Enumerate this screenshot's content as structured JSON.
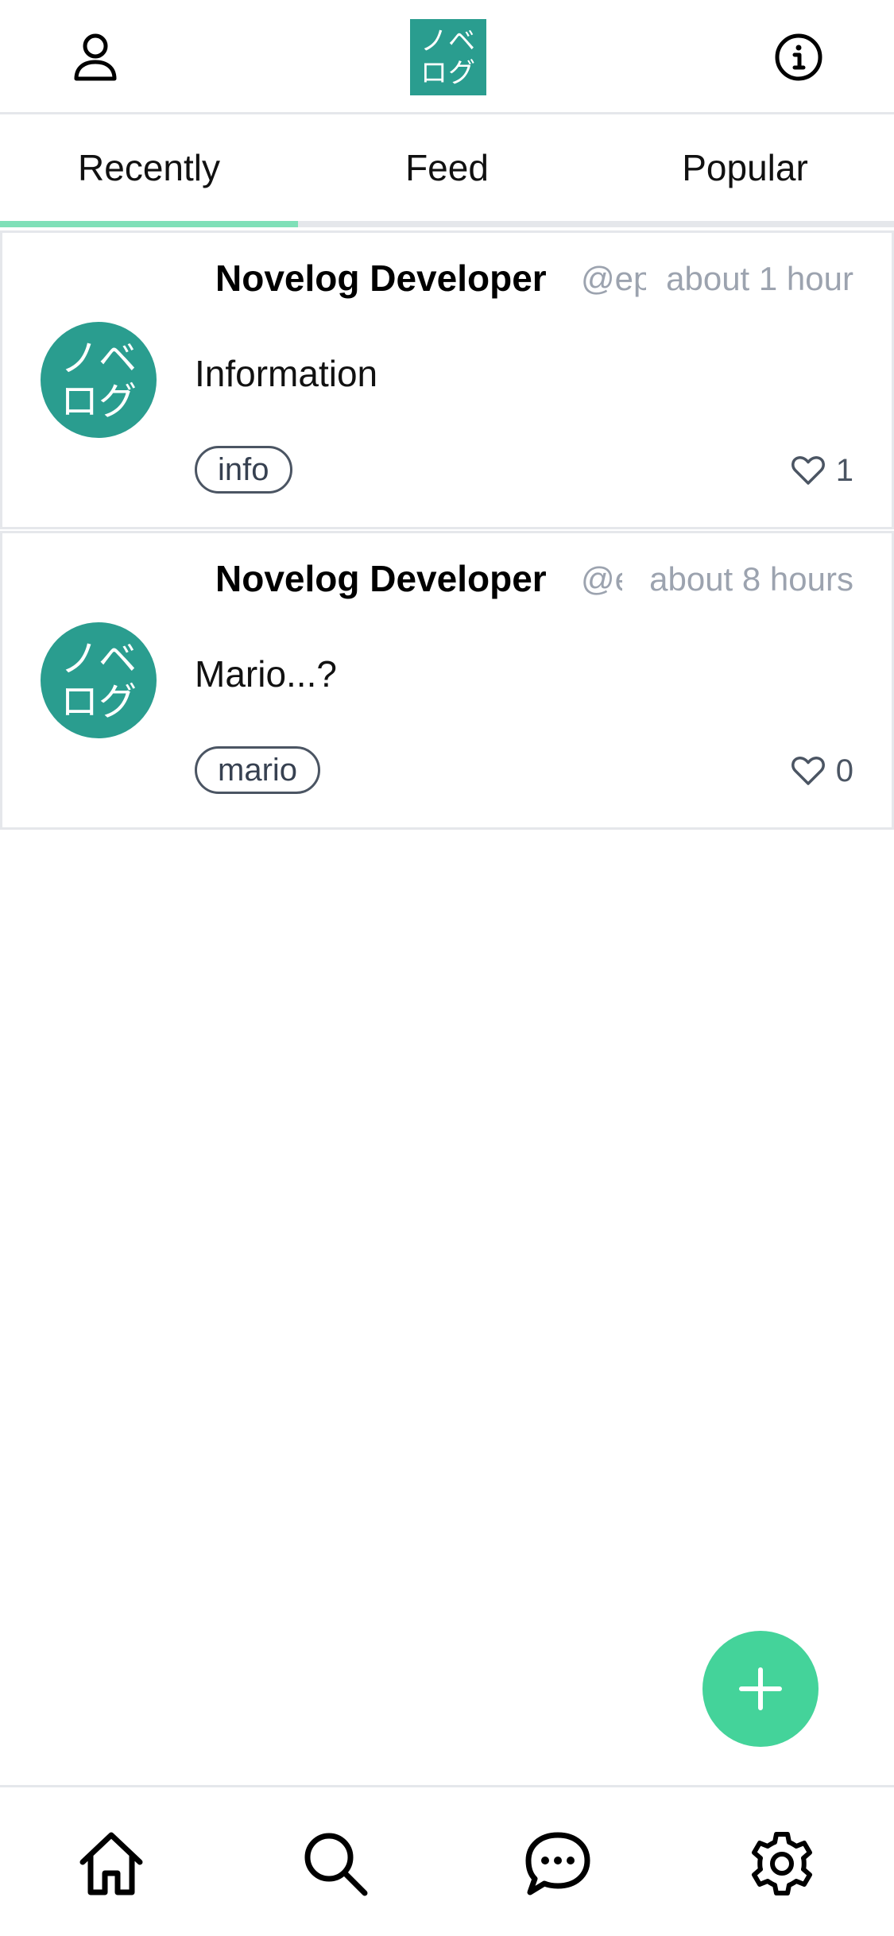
{
  "header": {
    "profile_icon": "user-icon",
    "info_icon": "info-icon",
    "logo_line1": "ノベ",
    "logo_line2": "ログ"
  },
  "tabs": [
    {
      "label": "Recently",
      "active": true
    },
    {
      "label": "Feed",
      "active": false
    },
    {
      "label": "Popular",
      "active": false
    }
  ],
  "posts": [
    {
      "author": "Novelog Developer",
      "handle": "@ep",
      "time": "about 1 hour",
      "title": "Information",
      "tag": "info",
      "likes": "1",
      "avatar_line1": "ノベ",
      "avatar_line2": "ログ"
    },
    {
      "author": "Novelog Developer",
      "handle": "@e",
      "time": "about 8 hours",
      "title": "Mario...?",
      "tag": "mario",
      "likes": "0",
      "avatar_line1": "ノベ",
      "avatar_line2": "ログ"
    }
  ],
  "fab": {
    "icon": "plus-icon"
  },
  "bottom_nav": [
    {
      "icon": "home-icon"
    },
    {
      "icon": "search-icon"
    },
    {
      "icon": "chat-icon"
    },
    {
      "icon": "gear-icon"
    }
  ],
  "colors": {
    "brand": "#2a9d8f",
    "accent": "#44d39a",
    "tab_indicator": "#7fe0b8",
    "muted_text": "#9ca3af"
  }
}
